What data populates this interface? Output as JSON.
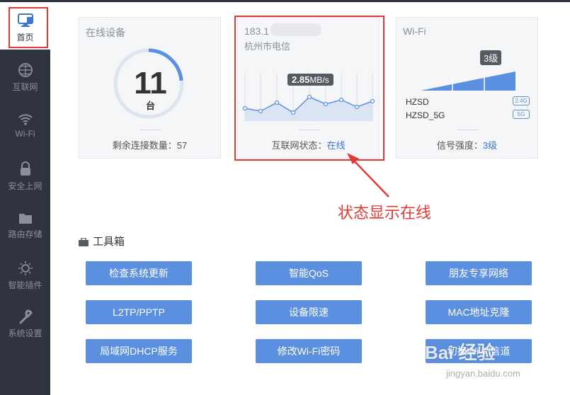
{
  "sidebar": {
    "items": [
      {
        "label": "首页",
        "icon": "monitor-icon"
      },
      {
        "label": "互联网",
        "icon": "globe-icon"
      },
      {
        "label": "Wi-Fi",
        "icon": "wifi-icon"
      },
      {
        "label": "安全上网",
        "icon": "lock-icon"
      },
      {
        "label": "路由存储",
        "icon": "folder-icon"
      },
      {
        "label": "智能插件",
        "icon": "bulb-icon"
      },
      {
        "label": "系统设置",
        "icon": "wrench-icon"
      }
    ]
  },
  "devices_card": {
    "title": "在线设备",
    "count": "11",
    "unit": "台",
    "remaining_label": "剩余连接数量：",
    "remaining_value": "57"
  },
  "internet_card": {
    "ip": "183.1",
    "isp": "杭州市电信",
    "speed_value": "2.85",
    "speed_unit": "MB/s",
    "status_label": "互联网状态：",
    "status_value": "在线"
  },
  "wifi_card": {
    "title": "Wi-Fi",
    "level": "3级",
    "ssids": [
      {
        "name": "HZSD",
        "band": "2.4G"
      },
      {
        "name": "HZSD_5G",
        "band": "5G"
      }
    ],
    "signal_label": "信号强度：",
    "signal_value": "3级"
  },
  "annotation": "状态显示在线",
  "toolbox": {
    "title": "工具箱",
    "buttons": [
      "检查系统更新",
      "智能QoS",
      "朋友专享网络",
      "L2TP/PPTP",
      "设备限速",
      "MAC地址克隆",
      "局域网DHCP服务",
      "修改Wi-Fi密码",
      "切换Wi-Fi信道"
    ]
  },
  "watermark": {
    "brand": "Bai 经验",
    "url": "jingyan.baidu.com"
  },
  "colors": {
    "accent": "#5b90e0",
    "sidebar": "#2f3440",
    "highlight": "#e53935"
  }
}
